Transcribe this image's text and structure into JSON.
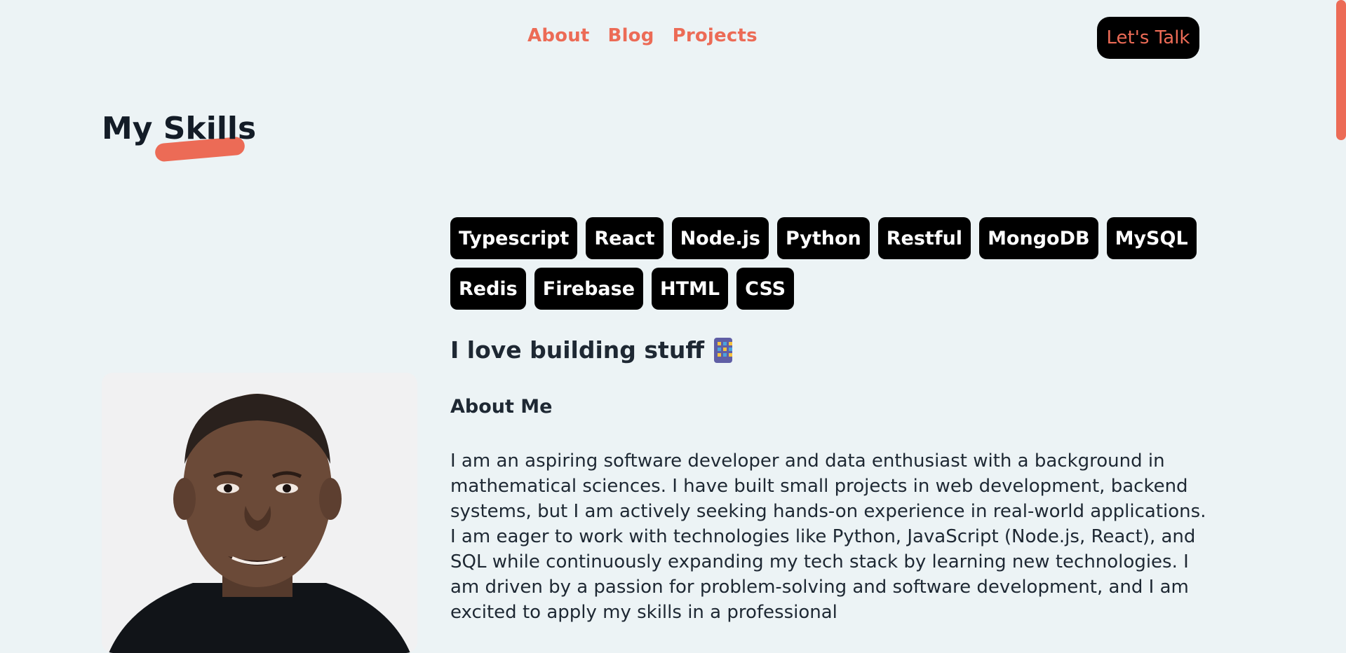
{
  "nav": {
    "links": [
      "About",
      "Blog",
      "Projects"
    ],
    "cta_label": "Let's Talk"
  },
  "skills_section": {
    "title": "My Skills",
    "skills": [
      "Typescript",
      "React",
      "Node.js",
      "Python",
      "Restful",
      "MongoDB",
      "MySQL",
      "Redis",
      "Firebase",
      "HTML",
      "CSS"
    ]
  },
  "tagline": "I love building stuff",
  "tagline_icon": "building-icon",
  "about": {
    "title": "About Me",
    "text": "I am an aspiring software developer and data enthusiast with a background in mathematical sciences. I have built small projects in web development, backend systems, but I am actively seeking hands-on experience in real-world applications. I am eager to work with technologies like Python, JavaScript (Node.js, React), and SQL while continuously expanding my tech stack by learning new technologies. I am driven by a passion for problem-solving and software development, and I am excited to apply my skills in a professional"
  },
  "colors": {
    "accent": "#ec6b56",
    "background": "#ecf3f5",
    "chip": "#000000",
    "text": "#1e2833"
  }
}
